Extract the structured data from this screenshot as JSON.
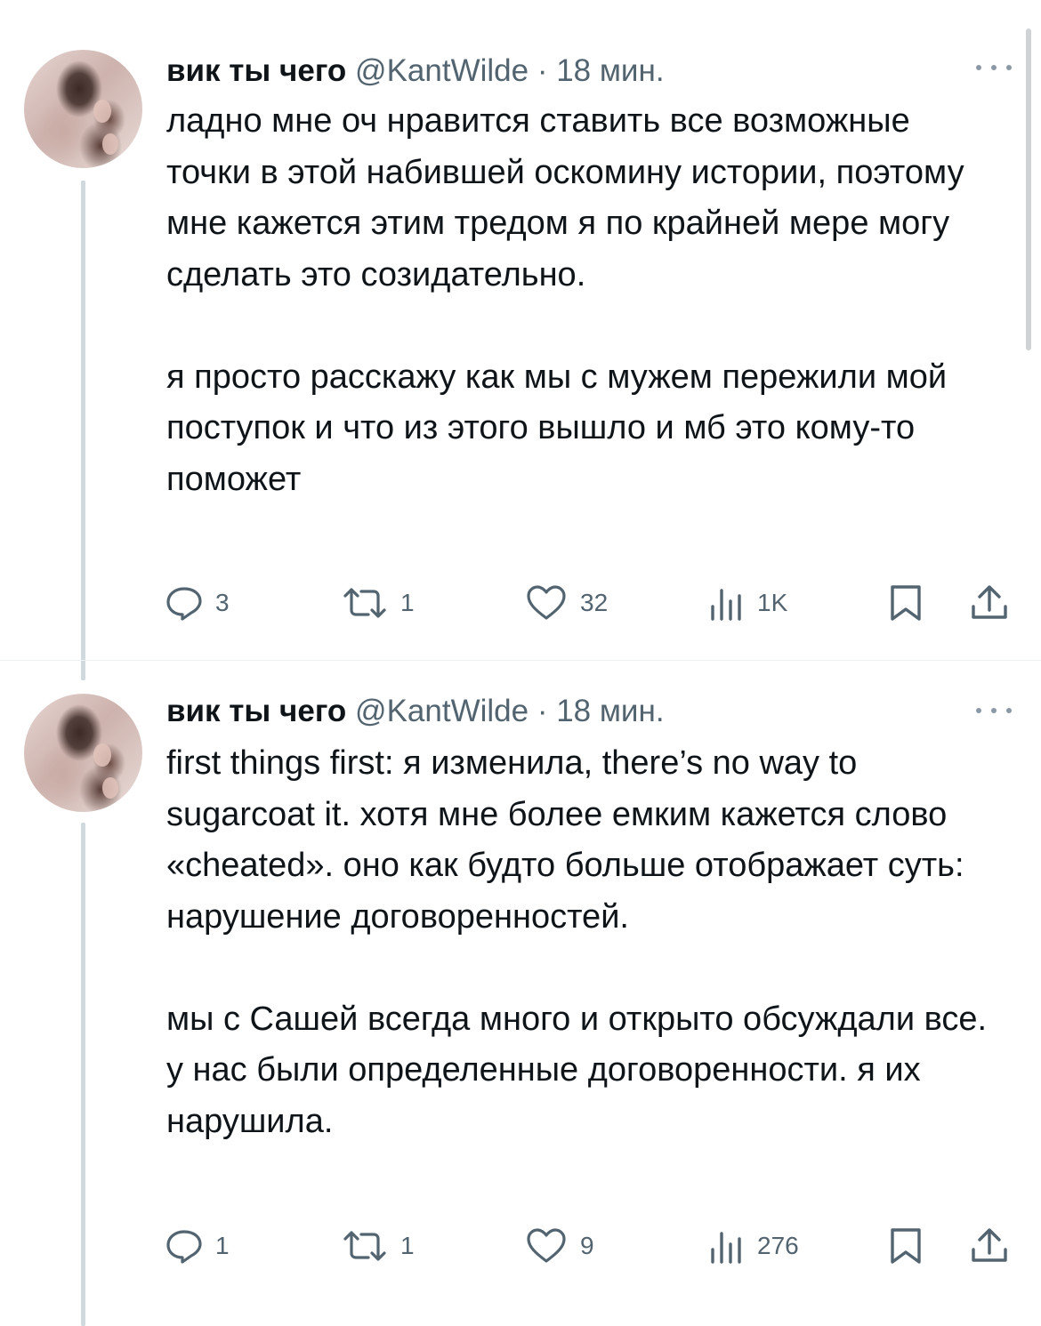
{
  "tweets": [
    {
      "name": "вик ты чего",
      "handle": "@KantWilde",
      "separator": "·",
      "time": "18 мин.",
      "paragraphs": [
        "ладно мне оч нравится ставить все возможные точки в этой набившей оскомину истории, поэтому мне кажется этим тредом я по крайней мере могу сделать это созидательно.",
        "я просто расскажу как мы с мужем пережили мой поступок и что из этого вышло и мб это кому-то поможет"
      ],
      "actions": {
        "replies": "3",
        "retweets": "1",
        "likes": "32",
        "views": "1K"
      }
    },
    {
      "name": "вик ты чего",
      "handle": "@KantWilde",
      "separator": "·",
      "time": "18 мин.",
      "paragraphs": [
        "first things first: я изменила, there’s no way to sugarcoat it. хотя мне более емким кажется слово «cheated». оно как будто больше отображает суть: нарушение договоренностей.",
        "мы с Сашей всегда много и открыто обсуждали все. у нас были определенные договоренности. я их нарушила."
      ],
      "actions": {
        "replies": "1",
        "retweets": "1",
        "likes": "9",
        "views": "276"
      }
    }
  ],
  "icons": [
    "reply-icon",
    "retweet-icon",
    "like-icon",
    "views-icon",
    "bookmark-icon",
    "share-icon",
    "more-icon"
  ],
  "colors": {
    "text": "#0f1419",
    "secondary": "#536471",
    "thread_line": "#cfd9de"
  }
}
